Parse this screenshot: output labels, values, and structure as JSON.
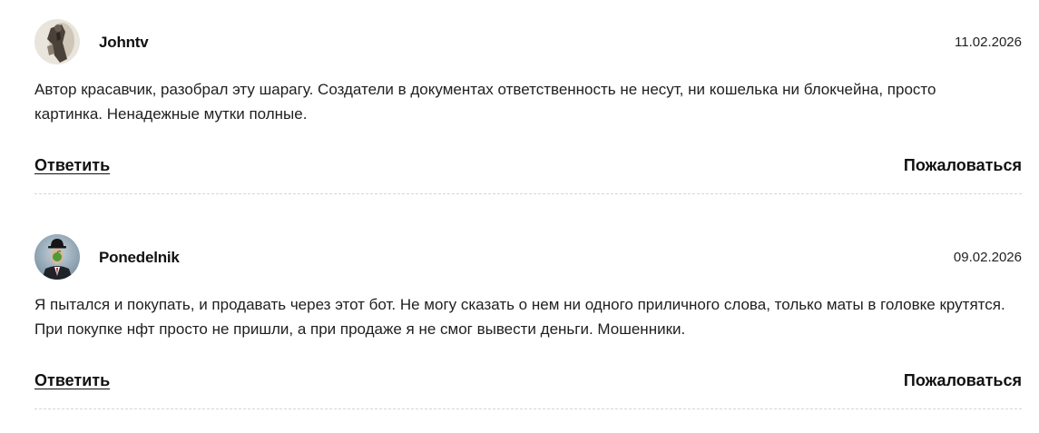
{
  "comments": [
    {
      "username": "Johntv",
      "date": "11.02.2026",
      "text": "Автор красавчик, разобрал эту шарагу. Создатели в документах ответственность не несут, ни кошелька ни блокчейна, просто картинка. Ненадежные мутки полные.",
      "reply_label": "Ответить",
      "report_label": "Пожаловаться",
      "avatar_icon": "user-photo-icon"
    },
    {
      "username": "Ponedelnik",
      "date": "09.02.2026",
      "text": "Я пытался и покупать, и продавать через этот бот. Не могу сказать о нем ни одного приличного слова, только маты в головке крутятся. При покупке нфт просто не пришли, а при продаже я не смог вывести деньги. Мошенники.",
      "reply_label": "Ответить",
      "report_label": "Пожаловаться",
      "avatar_icon": "bowler-hat-man-icon"
    }
  ]
}
